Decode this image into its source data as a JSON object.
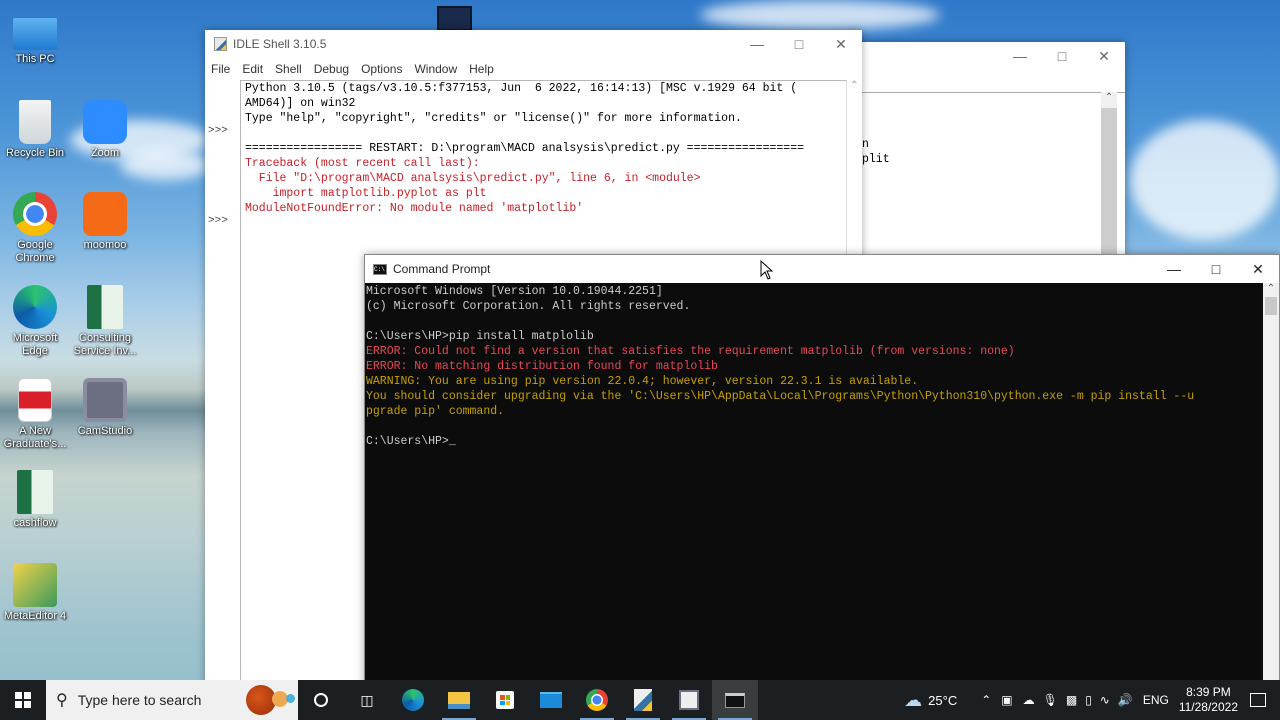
{
  "desktop": {
    "icons": [
      {
        "label": "This PC",
        "icon": "computer-icon"
      },
      {
        "label": "Recycle Bin",
        "icon": "recycle-bin-icon"
      },
      {
        "label": "Zoom",
        "icon": "zoom-app-icon"
      },
      {
        "label": "Google Chrome",
        "icon": "chrome-icon"
      },
      {
        "label": "moomoo",
        "icon": "moomoo-icon"
      },
      {
        "label": "Microsoft Edge",
        "icon": "edge-icon"
      },
      {
        "label": "Consulting Service Inv...",
        "icon": "excel-file-icon"
      },
      {
        "label": "A New Graduate's...",
        "icon": "pdf-file-icon"
      },
      {
        "label": "CamStudio",
        "icon": "camstudio-icon"
      },
      {
        "label": "cashflow",
        "icon": "excel-file-icon"
      },
      {
        "label": "MetaEditor 4",
        "icon": "metaeditor-icon"
      }
    ]
  },
  "idle": {
    "title": "IDLE Shell 3.10.5",
    "menu": [
      "File",
      "Edit",
      "Shell",
      "Debug",
      "Options",
      "Window",
      "Help"
    ],
    "prompt": ">>>",
    "lines": [
      {
        "text": "Python 3.10.5 (tags/v3.10.5:f377153, Jun  6 2022, 16:14:13) [MSC v.1929 64 bit (",
        "kind": "normal"
      },
      {
        "text": "AMD64)] on win32",
        "kind": "normal"
      },
      {
        "text": "Type \"help\", \"copyright\", \"credits\" or \"license()\" for more information.",
        "kind": "normal"
      },
      {
        "text": "",
        "kind": "normal"
      },
      {
        "text": "================= RESTART: D:\\program\\MACD analsysis\\predict.py =================",
        "kind": "normal"
      },
      {
        "text": "Traceback (most recent call last):",
        "kind": "error"
      },
      {
        "text": "  File \"D:\\program\\MACD analsysis\\predict.py\", line 6, in <module>",
        "kind": "error"
      },
      {
        "text": "    import matplotlib.pyplot as plt",
        "kind": "error"
      },
      {
        "text": "ModuleNotFoundError: No module named 'matplotlib'",
        "kind": "error"
      }
    ]
  },
  "bg_window": {
    "partial_lines": [
      "n",
      "plit"
    ]
  },
  "cmd": {
    "title": "Command Prompt",
    "lines": [
      {
        "text": "Microsoft Windows [Version 10.0.19044.2251]",
        "kind": "normal"
      },
      {
        "text": "(c) Microsoft Corporation. All rights reserved.",
        "kind": "normal"
      },
      {
        "text": "",
        "kind": "normal"
      },
      {
        "text": "C:\\Users\\HP>pip install matplolib",
        "kind": "normal"
      },
      {
        "text": "ERROR: Could not find a version that satisfies the requirement matplolib (from versions: none)",
        "kind": "red"
      },
      {
        "text": "ERROR: No matching distribution found for matplolib",
        "kind": "red"
      },
      {
        "text": "WARNING: You are using pip version 22.0.4; however, version 22.3.1 is available.",
        "kind": "yel"
      },
      {
        "text": "You should consider upgrading via the 'C:\\Users\\HP\\AppData\\Local\\Programs\\Python\\Python310\\python.exe -m pip install --u",
        "kind": "yel"
      },
      {
        "text": "pgrade pip' command.",
        "kind": "yel"
      },
      {
        "text": "",
        "kind": "normal"
      },
      {
        "text": "C:\\Users\\HP>",
        "kind": "prompt"
      }
    ]
  },
  "taskbar": {
    "search_placeholder": "Type here to search",
    "weather": "25°C",
    "language": "ENG",
    "time": "8:39 PM",
    "date": "11/28/2022",
    "apps": [
      "cortana-icon",
      "task-view-icon",
      "edge-icon",
      "file-explorer-icon",
      "microsoft-store-icon",
      "mail-icon",
      "chrome-icon",
      "python-idle-icon",
      "camstudio-icon",
      "command-prompt-icon"
    ]
  }
}
